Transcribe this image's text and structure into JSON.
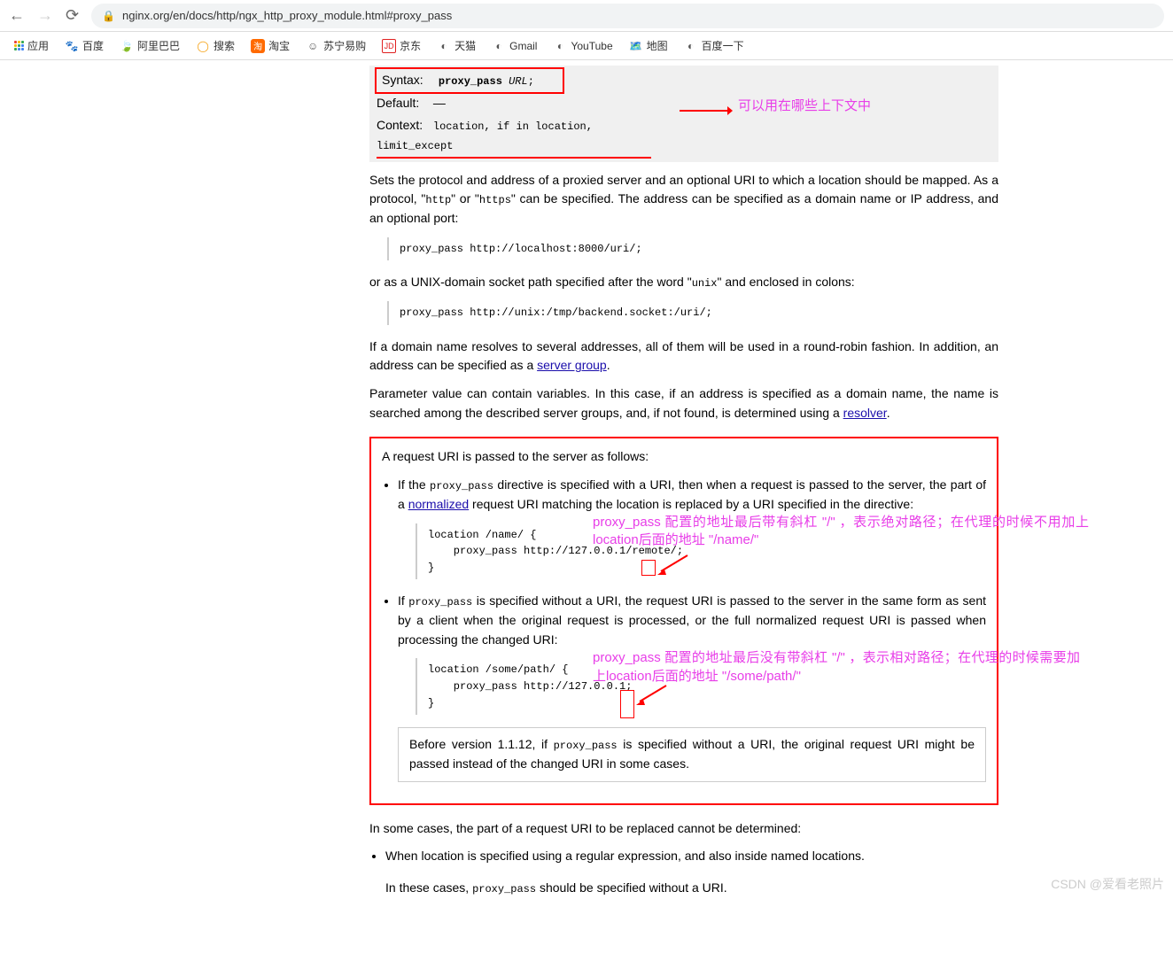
{
  "browser": {
    "url": "nginx.org/en/docs/http/ngx_http_proxy_module.html#proxy_pass"
  },
  "bookmarks": [
    "应用",
    "百度",
    "阿里巴巴",
    "搜索",
    "淘宝",
    "苏宁易购",
    "京东",
    "天猫",
    "Gmail",
    "YouTube",
    "地图",
    "百度一下"
  ],
  "directive": {
    "syntax_label": "Syntax:",
    "syntax_cmd": "proxy_pass",
    "syntax_arg": "URL",
    "default_label": "Default:",
    "default_val": "—",
    "context_label": "Context:",
    "context_val": "location, if in location, limit_except"
  },
  "annotations": {
    "context_note": "可以用在哪些上下文中",
    "slash_note": "proxy_pass 配置的地址最后带有斜杠 \"/\" ，表示绝对路径；在代理的时候不用加上location后面的地址 \"/name/\"",
    "noslash_note": "proxy_pass 配置的地址最后没有带斜杠 \"/\" ，表示相对路径；在代理的时候需要加上location后面的地址 \"/some/path/\""
  },
  "para1_a": "Sets the protocol and address of a proxied server and an optional URI to which a location should be mapped. As a protocol, \"",
  "para1_b": "\" or \"",
  "para1_c": "\" can be specified. The address can be specified as a domain name or IP address, and an optional port:",
  "http": "http",
  "https": "https",
  "code1": "proxy_pass http://localhost:8000/uri/;",
  "para2_a": "or as a UNIX-domain socket path specified after the word \"",
  "unix": "unix",
  "para2_b": "\" and enclosed in colons:",
  "code2": "proxy_pass http://unix:/tmp/backend.socket:/uri/;",
  "para3_a": "If a domain name resolves to several addresses, all of them will be used in a round-robin fashion. In addition, an address can be specified as a ",
  "server_group": "server group",
  "para4_a": "Parameter value can contain variables. In this case, if an address is specified as a domain name, the name is searched among the described server groups, and, if not found, is determined using a ",
  "resolver": "resolver",
  "para5": "A request URI is passed to the server as follows:",
  "li1_a": "If the ",
  "proxy_pass": "proxy_pass",
  "li1_b": " directive is specified with a URI, then when a request is passed to the server, the part of a ",
  "normalized": "normalized",
  "li1_c": " request URI matching the location is replaced by a URI specified in the directive:",
  "code3": "location /name/ {\n    proxy_pass http://127.0.0.1/remote/;\n}",
  "li2_a": "If ",
  "li2_b": " is specified without a URI, the request URI is passed to the server in the same form as sent by a client when the original request is processed, or the full normalized request URI is passed when processing the changed URI:",
  "code4": "location /some/path/ {\n    proxy_pass http://127.0.0.1;\n}",
  "note_a": "Before version 1.1.12, if ",
  "note_b": " is specified without a URI, the original request URI might be passed instead of the changed URI in some cases.",
  "para6": "In some cases, the part of a request URI to be replaced cannot be determined:",
  "li3": "When location is specified using a regular expression, and also inside named locations.",
  "li3_b_a": "In these cases, ",
  "li3_b_b": " should be specified without a URI.",
  "watermark": "CSDN @爱看老照片"
}
